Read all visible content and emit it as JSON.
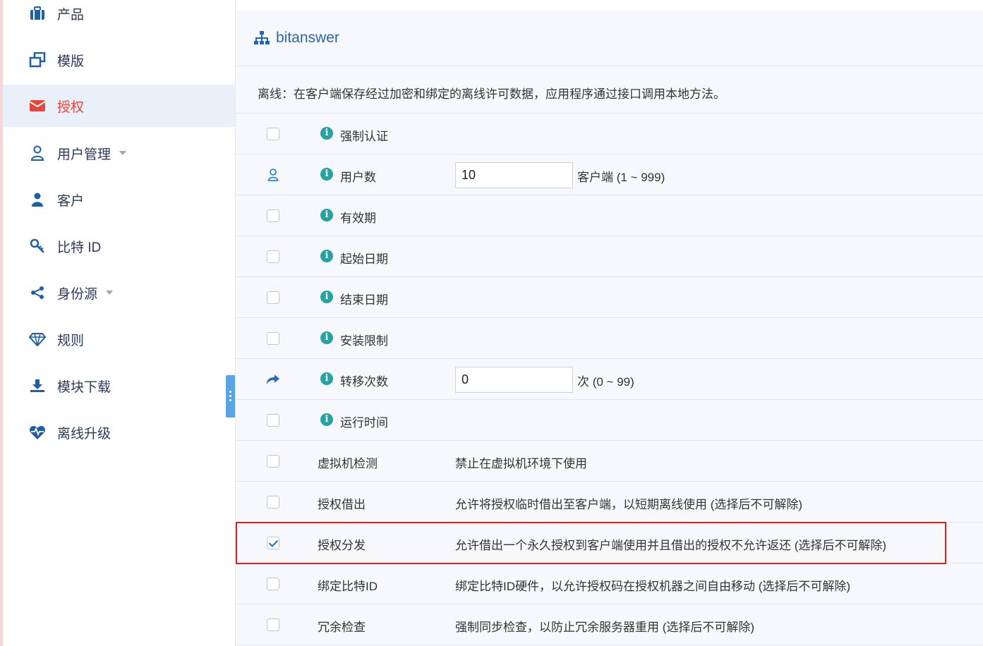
{
  "sidebar": {
    "items": [
      {
        "label": "产品",
        "icon": "briefcase-icon"
      },
      {
        "label": "模版",
        "icon": "clone-icon"
      },
      {
        "label": "授权",
        "icon": "envelope-icon",
        "active": true
      },
      {
        "label": "用户管理",
        "icon": "user-outline-icon",
        "has_caret": true
      },
      {
        "label": "客户",
        "icon": "user-icon"
      },
      {
        "label": "比特 ID",
        "icon": "key-icon"
      },
      {
        "label": "身份源",
        "icon": "share-icon",
        "has_caret": true
      },
      {
        "label": "规则",
        "icon": "diamond-icon"
      },
      {
        "label": "模块下载",
        "icon": "download-icon"
      },
      {
        "label": "离线升级",
        "icon": "heartbeat-icon"
      }
    ]
  },
  "panel": {
    "title": "bitanswer",
    "description": "离线：在客户端保存经过加密和绑定的离线许可数据，应用程序通过接口调用本地方法。"
  },
  "rows": [
    {
      "name": "强制认证"
    },
    {
      "name": "用户数",
      "value": "10",
      "unit": "客户端 (1 ~ 999)"
    },
    {
      "name": "有效期"
    },
    {
      "name": "起始日期"
    },
    {
      "name": "结束日期"
    },
    {
      "name": "安装限制"
    },
    {
      "name": "转移次数",
      "value": "0",
      "unit": "次 (0 ~ 99)"
    },
    {
      "name": "运行时间"
    },
    {
      "name": "虚拟机检测",
      "text": "禁止在虚拟机环境下使用"
    },
    {
      "name": "授权借出",
      "text": "允许将授权临时借出至客户端，以短期离线使用 (选择后不可解除)"
    },
    {
      "name": "授权分发",
      "text": "允许借出一个永久授权到客户端使用并且借出的授权不允许返还 (选择后不可解除)",
      "checked": true
    },
    {
      "name": "绑定比特ID",
      "text": "绑定比特ID硬件，以允许授权码在授权机器之间自由移动 (选择后不可解除)"
    },
    {
      "name": "冗余检查",
      "text": "强制同步检查，以防止冗余服务器重用 (选择后不可解除)"
    }
  ],
  "colors": {
    "accent": "#2866b0",
    "active_text": "#e8453c",
    "info": "#27a2a0",
    "highlight_border": "#d9201c"
  }
}
